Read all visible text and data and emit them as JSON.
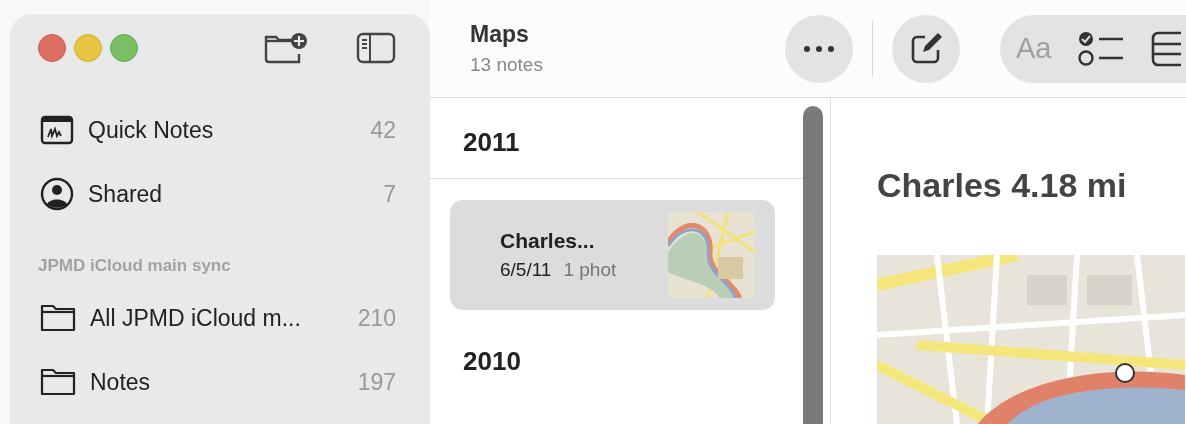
{
  "sidebar": {
    "sections": [
      {
        "items": [
          {
            "kind": "quick_notes",
            "label": "Quick Notes",
            "count": "42"
          },
          {
            "kind": "shared",
            "label": "Shared",
            "count": "7"
          }
        ]
      },
      {
        "header": "JPMD iCloud main sync",
        "items": [
          {
            "kind": "folder",
            "label": "All JPMD iCloud m...",
            "count": "210"
          },
          {
            "kind": "folder",
            "label": "Notes",
            "count": "197"
          }
        ]
      }
    ]
  },
  "toolbar": {
    "title": "Maps",
    "subtitle": "13 notes",
    "format_label": "Aa"
  },
  "note_list": {
    "groups": [
      {
        "heading": "2011",
        "notes": [
          {
            "title": "Charles...",
            "date": "6/5/11",
            "preview": "1 phot",
            "selected": true
          }
        ]
      },
      {
        "heading": "2010"
      }
    ]
  },
  "note": {
    "title": "Charles 4.18 mi"
  }
}
